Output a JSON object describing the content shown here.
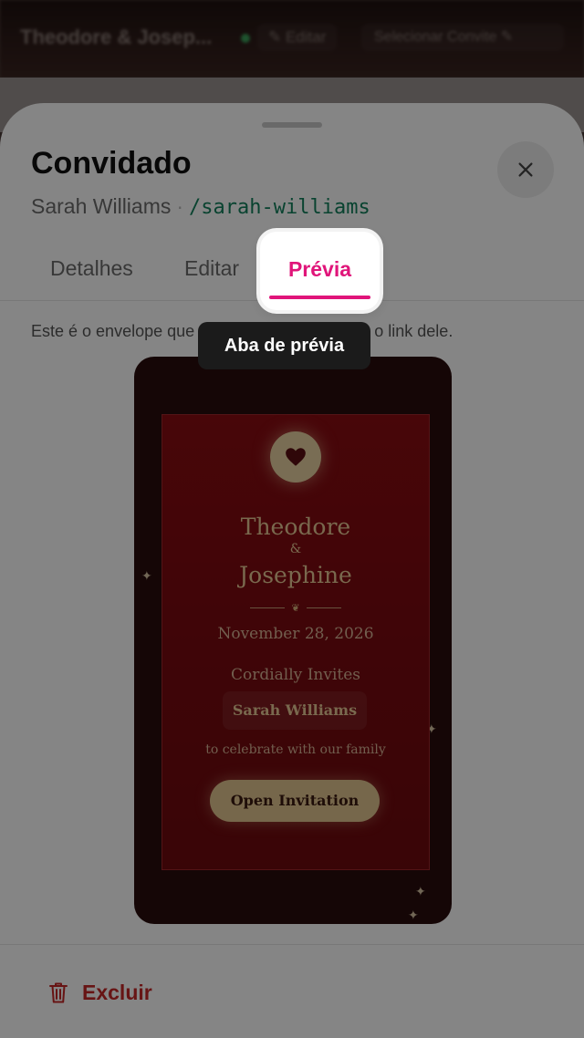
{
  "background": {
    "title": "Theodore & Josep...",
    "edit_label": "✎ Editar",
    "select_label": "Selecionar Convite ✎"
  },
  "sheet": {
    "title": "Convidado",
    "guest_name": "Sarah Williams",
    "separator": "·",
    "slug": "/sarah-williams",
    "tabs": [
      {
        "label": "Detalhes"
      },
      {
        "label": "Editar"
      },
      {
        "label": "Prévia",
        "active": true
      }
    ],
    "description": "Este é o envelope que o convidado vê ao abrir o link dele.",
    "delete_label": "Excluir"
  },
  "tooltip": {
    "text": "Aba de prévia"
  },
  "preview": {
    "name1": "Theodore",
    "ampersand": "&",
    "name2": "Josephine",
    "ornament": "❦",
    "date": "November 28, 2026",
    "invites": "Cordially Invites",
    "guest": "Sarah Williams",
    "celebrate": "to celebrate with our family",
    "open_button": "Open Invitation"
  },
  "colors": {
    "accent": "#e0157a",
    "slug": "#12805c",
    "danger": "#c62828",
    "card": "#7a0a10",
    "gold": "#e2c590"
  }
}
